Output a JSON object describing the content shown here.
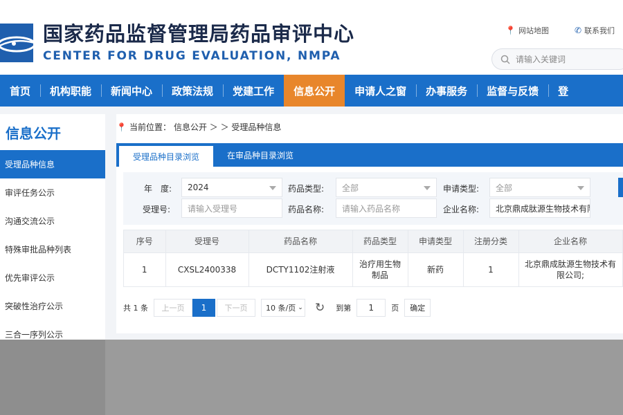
{
  "header": {
    "title_cn": "国家药品监督管理局药品审评中心",
    "title_en": "CENTER FOR DRUG EVALUATION, NMPA",
    "links": [
      {
        "label": "网站地图",
        "icon": "map-pin-icon"
      },
      {
        "label": "联系我们",
        "icon": "phone-icon"
      }
    ],
    "search_placeholder": "请输入关键词"
  },
  "nav": {
    "items": [
      {
        "label": "首页"
      },
      {
        "label": "机构职能"
      },
      {
        "label": "新闻中心"
      },
      {
        "label": "政策法规"
      },
      {
        "label": "党建工作"
      },
      {
        "label": "信息公开",
        "active": true
      },
      {
        "label": "申请人之窗"
      },
      {
        "label": "办事服务"
      },
      {
        "label": "监督与反馈"
      },
      {
        "label": "登"
      }
    ],
    "active_color": "#e8862b",
    "bar_color": "#1a6fc9"
  },
  "sidebar": {
    "title": "信息公开",
    "items": [
      {
        "label": "受理品种信息",
        "active": true
      },
      {
        "label": "审评任务公示"
      },
      {
        "label": "沟通交流公示"
      },
      {
        "label": "特殊审批品种列表"
      },
      {
        "label": "优先审评公示"
      },
      {
        "label": "突破性治疗公示"
      },
      {
        "label": "三合一序列公示"
      }
    ]
  },
  "breadcrumb": {
    "prefix": "当前位置：",
    "path": "信息公开 ＞ ＞ 受理品种信息"
  },
  "tabs": [
    {
      "label": "受理品种目录浏览",
      "active": true
    },
    {
      "label": "在审品种目录浏览"
    }
  ],
  "filters": {
    "year_label": "年　度:",
    "year_value": "2024",
    "drug_type_label": "药品类型:",
    "drug_type_value": "全部",
    "apply_type_label": "申请类型:",
    "apply_type_value": "全部",
    "accept_no_label": "受理号:",
    "accept_no_placeholder": "请输入受理号",
    "drug_name_label": "药品名称:",
    "drug_name_placeholder": "请输入药品名称",
    "company_label": "企业名称:",
    "company_value": "北京鼎成肽源生物技术有限"
  },
  "table": {
    "headers": [
      "序号",
      "受理号",
      "药品名称",
      "药品类型",
      "申请类型",
      "注册分类",
      "企业名称"
    ],
    "rows": [
      {
        "index": "1",
        "accept_no": "CXSL2400338",
        "drug_name": "DCTY1102注射液",
        "drug_type": "治疗用生物制品",
        "apply_type": "新药",
        "reg_class": "1",
        "company": "北京鼎成肽源生物技术有限公司;"
      }
    ]
  },
  "pager": {
    "total": "共 1 条",
    "prev": "上一页",
    "current": "1",
    "next": "下一页",
    "page_size": "10 条/页",
    "goto_label": "到第",
    "goto_value": "1",
    "page_unit": "页",
    "confirm": "确定"
  }
}
